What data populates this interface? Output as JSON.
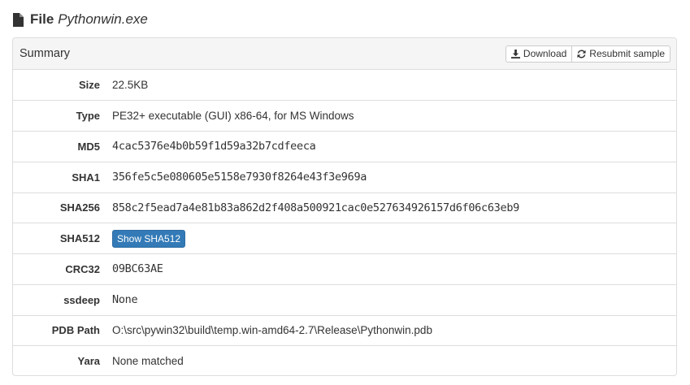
{
  "header": {
    "label": "File",
    "filename": "Pythonwin.exe",
    "icon": "file-icon"
  },
  "panel": {
    "title": "Summary",
    "buttons": {
      "download": "Download",
      "resubmit": "Resubmit sample"
    }
  },
  "rows": {
    "size": {
      "label": "Size",
      "value": "22.5KB"
    },
    "type": {
      "label": "Type",
      "value": "PE32+ executable (GUI) x86-64, for MS Windows"
    },
    "md5": {
      "label": "MD5",
      "value": "4cac5376e4b0b59f1d59a32b7cdfeeca"
    },
    "sha1": {
      "label": "SHA1",
      "value": "356fe5c5e080605e5158e7930f8264e43f3e969a"
    },
    "sha256": {
      "label": "SHA256",
      "value": "858c2f5ead7a4e81b83a862d2f408a500921cac0e527634926157d6f06c63eb9"
    },
    "sha512": {
      "label": "SHA512",
      "button": "Show SHA512"
    },
    "crc32": {
      "label": "CRC32",
      "value": "09BC63AE"
    },
    "ssdeep": {
      "label": "ssdeep",
      "value": "None"
    },
    "pdb_path": {
      "label": "PDB Path",
      "value": "O:\\src\\pywin32\\build\\temp.win-amd64-2.7\\Release\\Pythonwin.pdb"
    },
    "yara": {
      "label": "Yara",
      "value": "None matched"
    }
  },
  "colors": {
    "primary_button": "#337ab7",
    "panel_heading_bg": "#f5f5f5",
    "border": "#dddddd"
  }
}
